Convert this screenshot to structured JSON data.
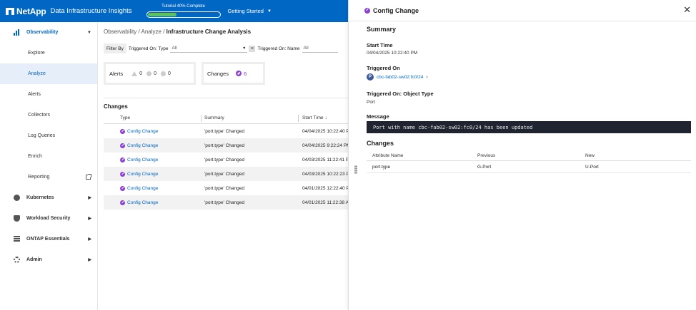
{
  "header": {
    "logo_text": "NetApp",
    "product": "Data Infrastructure Insights",
    "tutorial_label": "Tutorial 40% Complete",
    "tutorial_progress": 0.4,
    "getting_started": "Getting Started"
  },
  "sidebar": {
    "observability": "Observability",
    "sub_items": [
      "Explore",
      "Analyze",
      "Alerts",
      "Collectors",
      "Log Queries",
      "Enrich",
      "Reporting"
    ],
    "active_sub": "Analyze",
    "main_items": [
      "Kubernetes",
      "Workload Security",
      "ONTAP Essentials",
      "Admin"
    ]
  },
  "breadcrumb": {
    "part1": "Observability",
    "sep": "/",
    "part2": "Analyze",
    "current": "Infrastructure Change Analysis"
  },
  "filters": {
    "filter_by": "Filter By",
    "triggered_type_label": "Triggered On: Type",
    "triggered_type_value": "All",
    "triggered_name_label": "Triggered On: Name",
    "triggered_name_value": "All"
  },
  "summary_cards": {
    "alerts_label": "Alerts",
    "alert_counts": [
      "0",
      "0",
      "0"
    ],
    "changes_label": "Changes",
    "changes_count": "6"
  },
  "changes_table": {
    "title": "Changes",
    "columns": [
      "Type",
      "Summary",
      "Start Time"
    ],
    "sort_indicator": "↓",
    "rows": [
      {
        "type": "Config Change",
        "summary": "'port.type' Changed",
        "start_time": "04/04/2025 10:22:40 P"
      },
      {
        "type": "Config Change",
        "summary": "'port.type' Changed",
        "start_time": "04/04/2025 9:22:24 PM"
      },
      {
        "type": "Config Change",
        "summary": "'port.type' Changed",
        "start_time": "04/03/2025 11:22:41 P"
      },
      {
        "type": "Config Change",
        "summary": "'port.type' Changed",
        "start_time": "04/03/2025 10:22:23 P"
      },
      {
        "type": "Config Change",
        "summary": "'port.type' Changed",
        "start_time": "04/01/2025 12:22:40 P"
      },
      {
        "type": "Config Change",
        "summary": "'port.type' Changed",
        "start_time": "04/01/2025 11:22:38 A"
      }
    ]
  },
  "panel": {
    "title": "Config Change",
    "summary_title": "Summary",
    "start_time_label": "Start Time",
    "start_time_value": "04/04/2025 10:22:40 PM",
    "triggered_on_label": "Triggered On",
    "triggered_on_avatar": "P",
    "triggered_on_value": "cbc-fab02-sw02:fc0/24",
    "object_type_label": "Triggered On: Object Type",
    "object_type_value": "Port",
    "message_label": "Message",
    "message_value": "Port with name cbc-fab02-sw02:fc0/24 has been updated",
    "changes_title": "Changes",
    "changes_columns": [
      "Attribute Name",
      "Previous",
      "New"
    ],
    "changes_rows": [
      {
        "attribute": "port.type",
        "previous": "G-Port",
        "new": "U-Port"
      }
    ]
  },
  "colors": {
    "brand_blue": "#0067c5",
    "change_purple": "#8a3fd6",
    "progress_green": "#5cc25c"
  }
}
